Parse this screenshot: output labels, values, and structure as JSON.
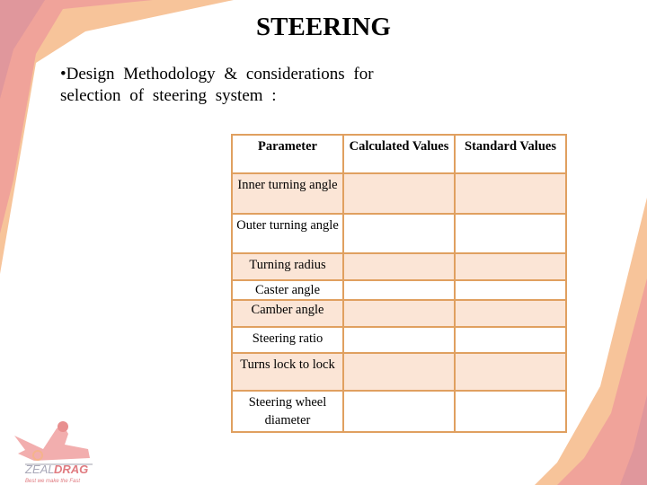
{
  "title": "STEERING",
  "bullet": {
    "line1": "•Design Methodology & considerations for",
    "line2": "selection of steering system :"
  },
  "table": {
    "headers": [
      "Parameter",
      "Calculated Values",
      "Standard Values"
    ],
    "rows": [
      {
        "parameter": "Inner turning angle",
        "calculated": "",
        "standard": ""
      },
      {
        "parameter": "Outer turning angle",
        "calculated": "",
        "standard": ""
      },
      {
        "parameter": "Turning radius",
        "calculated": "",
        "standard": ""
      },
      {
        "parameter": "Caster angle",
        "calculated": "",
        "standard": ""
      },
      {
        "parameter": "Camber angle",
        "calculated": "",
        "standard": ""
      },
      {
        "parameter": "Steering ratio",
        "calculated": "",
        "standard": ""
      },
      {
        "parameter": "Turns lock to lock",
        "calculated": "",
        "standard": ""
      },
      {
        "parameter": "Steering wheel diameter",
        "calculated": "",
        "standard": ""
      }
    ]
  },
  "logo": {
    "name": "ZEAL DRAG",
    "tagline": "Best we make the Fast"
  },
  "colors": {
    "border": "#e0a060",
    "shade": "#fbe5d6",
    "peach": "#f7c49a",
    "salmon": "#f0a39a",
    "rose": "#e0979c"
  }
}
